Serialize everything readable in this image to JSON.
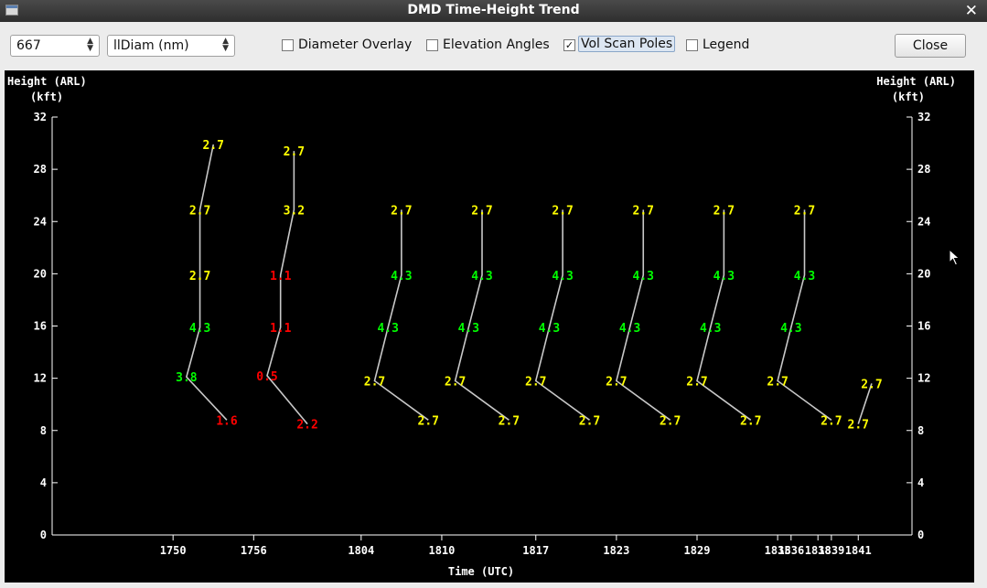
{
  "window": {
    "title": "DMD Time-Height Trend"
  },
  "toolbar": {
    "id_select": {
      "value": "667"
    },
    "param_select": {
      "value": "llDiam (nm)"
    },
    "options": [
      {
        "label": "Diameter Overlay",
        "checked": false
      },
      {
        "label": "Elevation Angles",
        "checked": false
      },
      {
        "label": "Vol Scan Poles",
        "checked": true
      },
      {
        "label": "Legend",
        "checked": false
      }
    ],
    "close_label": "Close"
  },
  "icons": {
    "window": "window-icon",
    "close": "close-x-icon",
    "spin": "spinner-arrows-icon",
    "cursor": "mouse-pointer-icon"
  },
  "chart_data": {
    "type": "line",
    "ylabel_left": [
      "Height (ARL)",
      "(kft)"
    ],
    "ylabel_right": [
      "Height (ARL)",
      "(kft)"
    ],
    "xlabel": "Time (UTC)",
    "ylim": [
      0,
      32
    ],
    "yticks": [
      0,
      4,
      8,
      12,
      16,
      20,
      24,
      28,
      32
    ],
    "xlim": [
      "1741",
      "1845"
    ],
    "xticks": [
      "1750",
      "1756",
      "1804",
      "1810",
      "1817",
      "1823",
      "1829",
      "1835",
      "1836",
      "1838",
      "1839",
      "1841"
    ],
    "label_colors": {
      "yellow": "#ffff00",
      "green": "#00ff00",
      "red": "#ff0000"
    },
    "pole_color": "#c8c8c8",
    "series": [
      {
        "points": [
          {
            "t": "1754",
            "h": 8.8,
            "label": "1.6",
            "color": "red"
          },
          {
            "t": "1751",
            "h": 12.1,
            "label": "3.8",
            "color": "green"
          },
          {
            "t": "1752",
            "h": 15.9,
            "label": "4.3",
            "color": "green"
          },
          {
            "t": "1752",
            "h": 19.9,
            "label": "2.7",
            "color": "yellow"
          },
          {
            "t": "1752",
            "h": 24.9,
            "label": "2.7",
            "color": "yellow"
          },
          {
            "t": "1753",
            "h": 29.9,
            "label": "2.7",
            "color": "yellow"
          }
        ]
      },
      {
        "points": [
          {
            "t": "1800",
            "h": 8.5,
            "label": "2.2",
            "color": "red"
          },
          {
            "t": "1757",
            "h": 12.2,
            "label": "0.5",
            "color": "red"
          },
          {
            "t": "1758",
            "h": 15.9,
            "label": "1.1",
            "color": "red"
          },
          {
            "t": "1758",
            "h": 19.9,
            "label": "1.1",
            "color": "red"
          },
          {
            "t": "1759",
            "h": 24.9,
            "label": "3.2",
            "color": "yellow"
          },
          {
            "t": "1759",
            "h": 29.4,
            "label": "2.7",
            "color": "yellow"
          }
        ]
      },
      {
        "points": [
          {
            "t": "1809",
            "h": 8.8,
            "label": "2.7",
            "color": "yellow"
          },
          {
            "t": "1805",
            "h": 11.8,
            "label": "2.7",
            "color": "yellow"
          },
          {
            "t": "1806",
            "h": 15.9,
            "label": "4.3",
            "color": "green"
          },
          {
            "t": "1807",
            "h": 19.9,
            "label": "4.3",
            "color": "green"
          },
          {
            "t": "1807",
            "h": 24.9,
            "label": "2.7",
            "color": "yellow"
          }
        ]
      },
      {
        "points": [
          {
            "t": "1815",
            "h": 8.8,
            "label": "2.7",
            "color": "yellow"
          },
          {
            "t": "1811",
            "h": 11.8,
            "label": "2.7",
            "color": "yellow"
          },
          {
            "t": "1812",
            "h": 15.9,
            "label": "4.3",
            "color": "green"
          },
          {
            "t": "1813",
            "h": 19.9,
            "label": "4.3",
            "color": "green"
          },
          {
            "t": "1813",
            "h": 24.9,
            "label": "2.7",
            "color": "yellow"
          }
        ]
      },
      {
        "points": [
          {
            "t": "1821",
            "h": 8.8,
            "label": "2.7",
            "color": "yellow"
          },
          {
            "t": "1817",
            "h": 11.8,
            "label": "2.7",
            "color": "yellow"
          },
          {
            "t": "1818",
            "h": 15.9,
            "label": "4.3",
            "color": "green"
          },
          {
            "t": "1819",
            "h": 19.9,
            "label": "4.3",
            "color": "green"
          },
          {
            "t": "1819",
            "h": 24.9,
            "label": "2.7",
            "color": "yellow"
          }
        ]
      },
      {
        "points": [
          {
            "t": "1827",
            "h": 8.8,
            "label": "2.7",
            "color": "yellow"
          },
          {
            "t": "1823",
            "h": 11.8,
            "label": "2.7",
            "color": "yellow"
          },
          {
            "t": "1824",
            "h": 15.9,
            "label": "4.3",
            "color": "green"
          },
          {
            "t": "1825",
            "h": 19.9,
            "label": "4.3",
            "color": "green"
          },
          {
            "t": "1825",
            "h": 24.9,
            "label": "2.7",
            "color": "yellow"
          }
        ]
      },
      {
        "points": [
          {
            "t": "1833",
            "h": 8.8,
            "label": "2.7",
            "color": "yellow"
          },
          {
            "t": "1829",
            "h": 11.8,
            "label": "2.7",
            "color": "yellow"
          },
          {
            "t": "1830",
            "h": 15.9,
            "label": "4.3",
            "color": "green"
          },
          {
            "t": "1831",
            "h": 19.9,
            "label": "4.3",
            "color": "green"
          },
          {
            "t": "1831",
            "h": 24.9,
            "label": "2.7",
            "color": "yellow"
          }
        ]
      },
      {
        "points": [
          {
            "t": "1839",
            "h": 8.8,
            "label": "2.7",
            "color": "yellow"
          },
          {
            "t": "1835",
            "h": 11.8,
            "label": "2.7",
            "color": "yellow"
          },
          {
            "t": "1836",
            "h": 15.9,
            "label": "4.3",
            "color": "green"
          },
          {
            "t": "1837",
            "h": 19.9,
            "label": "4.3",
            "color": "green"
          },
          {
            "t": "1837",
            "h": 24.9,
            "label": "2.7",
            "color": "yellow"
          }
        ]
      },
      {
        "points": [
          {
            "t": "1841",
            "h": 8.5,
            "label": "2.7",
            "color": "yellow"
          },
          {
            "t": "1842",
            "h": 11.6,
            "label": "2.7",
            "color": "yellow"
          }
        ]
      }
    ]
  }
}
